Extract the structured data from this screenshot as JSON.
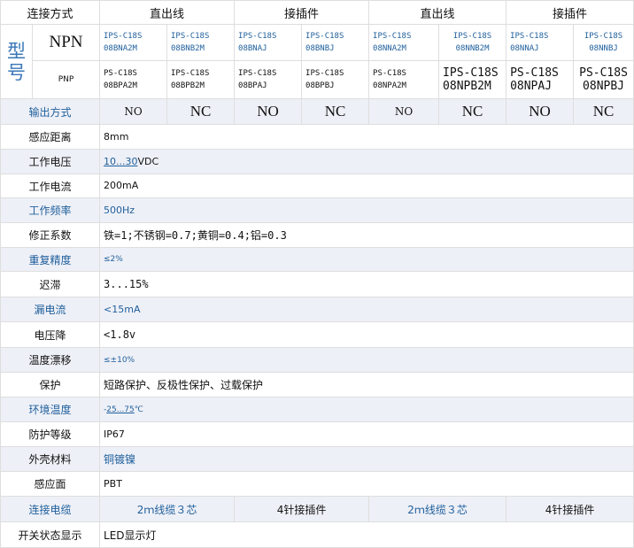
{
  "header": {
    "label": "连接方式",
    "col1": "直出线",
    "col2": "接插件",
    "col3": "直出线",
    "col4": "接插件"
  },
  "model": {
    "label_char1": "型",
    "label_char2": "号",
    "npn": "NPN",
    "pnp": "PNP",
    "npn_models": [
      [
        "IPS-C18S",
        "08BNA2M"
      ],
      [
        "IPS-C18S",
        "08BNB2M"
      ],
      [
        "IPS-C18S",
        "08BNAJ"
      ],
      [
        "IPS-C18S",
        "08BNBJ"
      ],
      [
        "IPS-C18S",
        "08NNA2M"
      ],
      [
        "IPS-C18S",
        "08NNB2M"
      ],
      [
        "IPS-C18S",
        "08NNAJ"
      ],
      [
        "IPS-C18S",
        "08NNBJ"
      ]
    ],
    "pnp_models": [
      [
        "PS-C18S",
        "08BPA2M"
      ],
      [
        "IPS-C18S",
        "08BPB2M"
      ],
      [
        "IPS-C18S",
        "08BPAJ"
      ],
      [
        "IPS-C18S",
        "08BPBJ"
      ],
      [
        "PS-C18S",
        "08NPA2M"
      ],
      [
        "IPS-C18S",
        "08NPB2M"
      ],
      [
        "PS-C18S",
        "08NPAJ"
      ],
      [
        "PS-C18S",
        "08NPBJ"
      ]
    ]
  },
  "output": {
    "label": "输出方式",
    "values": [
      "NO",
      "NC",
      "NO",
      "NC",
      "NO",
      "NC",
      "NO",
      "NC"
    ]
  },
  "specs": [
    {
      "label": "感应距离",
      "value": "8mm"
    },
    {
      "label": "工作电压",
      "value_link": "10...30",
      "value_suffix": "VDC"
    },
    {
      "label": "工作电流",
      "value": "200mA"
    },
    {
      "label": "工作频率",
      "value": "500Hz"
    },
    {
      "label": "修正系数",
      "value": "铁=1;不锈钢=0.7;黄铜=0.4;铝=0.3"
    },
    {
      "label": "重复精度",
      "value": "≤2%"
    },
    {
      "label": "迟滞",
      "value": "3...15%"
    },
    {
      "label": "漏电流",
      "value": "<15mA"
    },
    {
      "label": "电压降",
      "value": "<1.8v"
    },
    {
      "label": "温度漂移",
      "value": "≤±10%"
    },
    {
      "label": "保护",
      "value": "短路保护、反极性保护、过载保护"
    },
    {
      "label": "环境温度",
      "value_prefix": "-",
      "value_link": "25...75",
      "value_suffix": "℃"
    },
    {
      "label": "防护等级",
      "value": "IP67"
    },
    {
      "label": "外壳材料",
      "value": "铜镀镍"
    },
    {
      "label": "感应面",
      "value": "PBT"
    }
  ],
  "cable": {
    "label": "连接电缆",
    "col1": "2ｍ线缆３芯",
    "col2": "4针接插件",
    "col3": "2ｍ线缆３芯",
    "col4": "4针接插件"
  },
  "status": {
    "label": "开关状态显示",
    "value": "LED显示灯"
  },
  "colors": {
    "accent_blue": "#1f5f9c",
    "shade": "#eef0f7",
    "border": "#dedede"
  }
}
